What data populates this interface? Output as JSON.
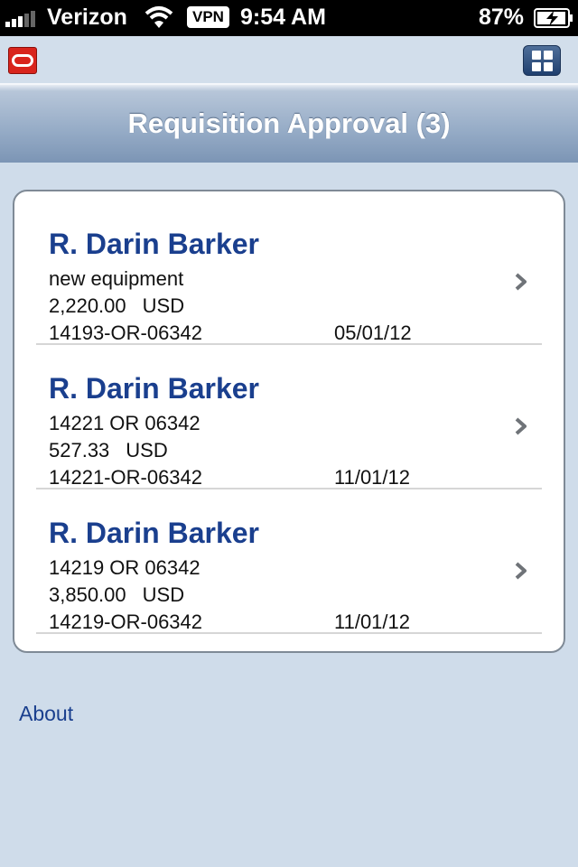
{
  "status_bar": {
    "carrier": "Verizon",
    "vpn": "VPN",
    "time": "9:54 AM",
    "battery": "87%"
  },
  "header": {
    "title": "Requisition Approval (3)"
  },
  "requisitions": [
    {
      "requester": "R. Darin Barker",
      "description": "new equipment",
      "amount": "2,220.00",
      "currency": "USD",
      "number": "14193-OR-06342",
      "date": "05/01/12"
    },
    {
      "requester": "R. Darin Barker",
      "description": "14221 OR 06342",
      "amount": "527.33",
      "currency": "USD",
      "number": "14221-OR-06342",
      "date": "11/01/12"
    },
    {
      "requester": "R. Darin Barker",
      "description": "14219 OR 06342",
      "amount": "3,850.00",
      "currency": "USD",
      "number": "14219-OR-06342",
      "date": "11/01/12"
    }
  ],
  "footer": {
    "about_label": "About"
  },
  "colors": {
    "accent": "#1a3f8e",
    "background": "#cfdcea",
    "logo_red": "#d9241c"
  },
  "icons": {
    "logo": "oracle-logo-icon",
    "apps": "grid-icon",
    "row_disclosure": "chevron-right-icon"
  }
}
